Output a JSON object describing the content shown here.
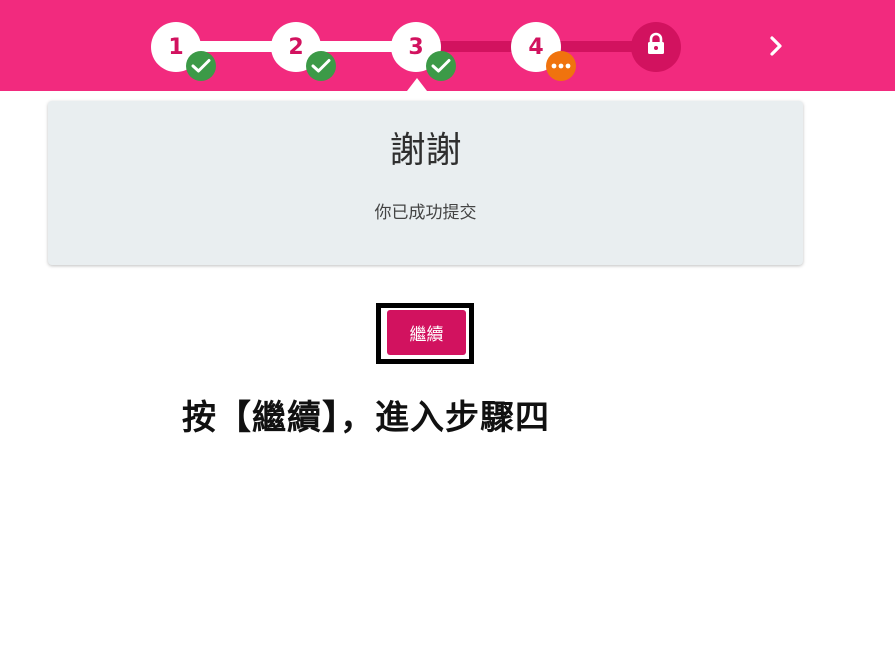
{
  "colors": {
    "header_bg": "#f22a7e",
    "accent": "#d2125f",
    "success_badge": "#3c9a47",
    "pending_badge": "#f0730e",
    "card_bg": "#e9eef0"
  },
  "stepper": {
    "steps": [
      {
        "label": "1",
        "status": "complete",
        "badge_icon": "check-icon"
      },
      {
        "label": "2",
        "status": "complete",
        "badge_icon": "check-icon"
      },
      {
        "label": "3",
        "status": "complete",
        "badge_icon": "check-icon",
        "current": true
      },
      {
        "label": "4",
        "status": "pending",
        "badge_icon": "ellipsis-icon"
      },
      {
        "label": "",
        "status": "locked",
        "icon": "lock-icon"
      }
    ],
    "next_icon": "chevron-right-icon"
  },
  "card": {
    "title": "謝謝",
    "message": "你已成功提交"
  },
  "continue_button": {
    "label": "繼續"
  },
  "instruction": {
    "text": "按【繼續】，進入步驟四"
  }
}
